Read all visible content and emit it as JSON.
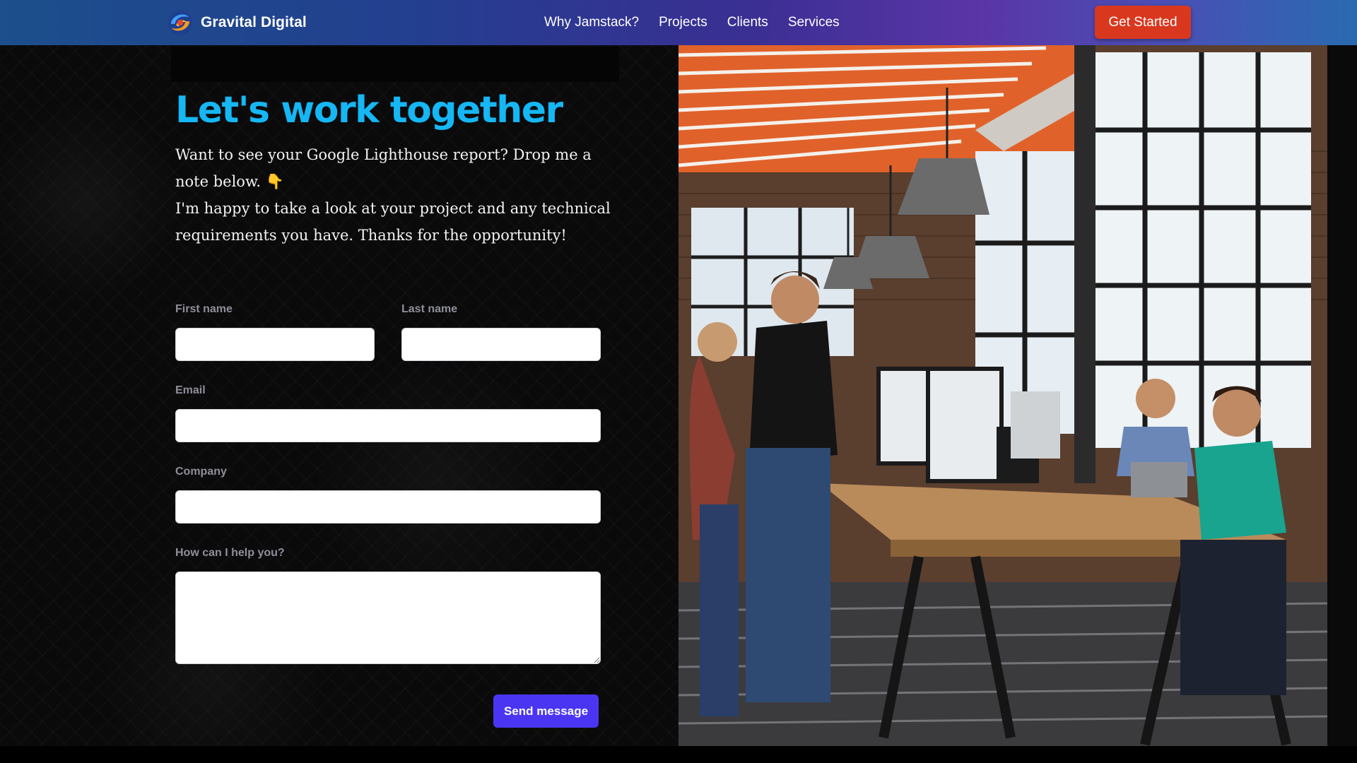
{
  "nav": {
    "brand_name": "Gravital Digital",
    "links": [
      "Why Jamstack?",
      "Projects",
      "Clients",
      "Services"
    ],
    "cta_label": "Get Started"
  },
  "contact": {
    "heading": "Let's work together",
    "intro_line1": "Want to see your Google Lighthouse report? Drop me a note below. 👇",
    "intro_line2": "I'm happy to take a look at your project and any technical requirements you have. Thanks for the opportunity!",
    "fields": {
      "first_name": {
        "label": "First name",
        "value": ""
      },
      "last_name": {
        "label": "Last name",
        "value": ""
      },
      "email": {
        "label": "Email",
        "value": ""
      },
      "company": {
        "label": "Company",
        "value": ""
      },
      "message": {
        "label": "How can I help you?",
        "value": ""
      }
    },
    "submit_label": "Send message"
  },
  "colors": {
    "heading": "#15b7f4",
    "cta": "#d9381e",
    "submit": "#4a36f2",
    "label": "#8e8f99"
  },
  "icons": {
    "brand": "gravital-logo-icon",
    "intro_emoji": "pointing-down-emoji"
  }
}
